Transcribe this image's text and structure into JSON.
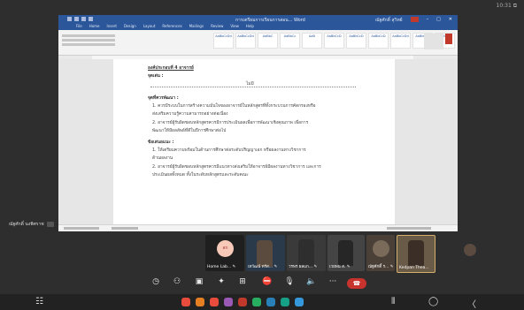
{
  "meeting": {
    "clock": "10:31 ⧉",
    "presenter_name": "ณัฐศักดิ์ นงพิศราช"
  },
  "word": {
    "doc_title": "การเตรียมการเรียนการสอน...  Word",
    "account": "ณัฐศักดิ์ สุวิทย์",
    "menu": [
      "File",
      "Home",
      "Insert",
      "Design",
      "Layout",
      "References",
      "Mailings",
      "Review",
      "View",
      "Help"
    ],
    "styles": [
      "AaBbCcDd",
      "AaBbCcDd",
      "AaBbC",
      "AaBbCc",
      "AaB",
      "AaBbCcD",
      "AaBbCcD",
      "AaBbCcD",
      "AaBbCcDd",
      "AaBbCcD",
      "AaBbCcD"
    ],
    "paragraph_heading": "องค์ประกอบที่ 4  อาจารย์",
    "strengths_label": "จุดเด่น :",
    "strengths_value": "ไม่มี",
    "improve_heading": "จุดที่ควรพัฒนา :",
    "improve_items": [
      "1.  ควรมีระบบในการสร้างความมั่นใจของอาจารย์ในหลักสูตรที่ทั้งกระบวนการคัดกรองหรือ",
      "    ส่งเสริมความรู้ความสามารถอย่างต่อเนื่อง",
      "2.  อาจารย์ผู้รับผิดชอบหลักสูตรควรมีการประเมินผลเพื่อการพัฒนาเชิงคุณภาพ เพื่อการ",
      "    พัฒนาให้มีผลลัพธ์ที่ดีในปีการศึกษาต่อไป"
    ],
    "suggest_heading": "ข้อเสนอแนะ :",
    "suggest_items": [
      "1.  ให้เตรียมความพร้อมในด้านการศึกษาต่อระดับปริญญาเอก หรือผลงานทางวิชาการ",
      "    ด้านผลงาน",
      "2.  อาจารย์ผู้รับผิดชอบหลักสูตรควรมีแนวทางส่งเสริมให้อาจารย์มีผลงานทางวิชาการ และการ",
      "    ประเมินผลทั้งหมด ทั้งในระดับหลักสูตรและระดับคณะ"
    ]
  },
  "participants": [
    {
      "label": "Home Lab... ✎",
      "avatar": "สก"
    },
    {
      "label": "เทวัฒน์ ทรัส... ✎",
      "avatar": ""
    },
    {
      "label": "วรพร ผลแก... ✎",
      "avatar": ""
    },
    {
      "label": "เวยพน ส. ✎",
      "avatar": ""
    },
    {
      "label": "ณัฐศักดิ์ ร... ✎",
      "avatar": ""
    },
    {
      "label": "Kedpan Thea...",
      "avatar": ""
    },
    {
      "label": "",
      "avatar": ""
    }
  ],
  "controls": {
    "timer_icon": "◷",
    "people_icon": "⚇",
    "chat_icon": "▣",
    "effects_icon": "✦",
    "grid_icon": "⊞",
    "camera_off_icon": "⛔",
    "mic_off_icon": "🎙",
    "speaker_icon": "🔈",
    "more_icon": "···",
    "hangup_icon": "☎"
  },
  "nav": {
    "menu_icon": "☷",
    "recents_icon": "⦀",
    "home_icon": "◯",
    "back_icon": "〈"
  },
  "colors": {
    "word_blue": "#2b579a",
    "hangup_red": "#c9332d",
    "background": "#2e2e2e"
  }
}
